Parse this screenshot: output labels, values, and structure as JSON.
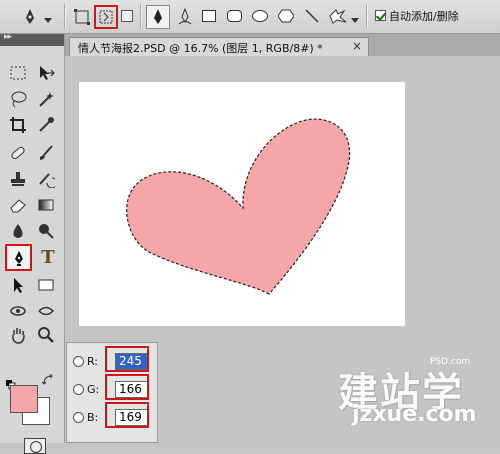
{
  "options_bar": {
    "auto_add_delete_label": "自动添加/删除",
    "auto_add_delete_checked": true
  },
  "toolbox": {
    "header": "▸▸",
    "type_tool_glyph": "T"
  },
  "document": {
    "tab_title": "情人节海报2.PSD @ 16.7% (图层 1, RGB/8#) *",
    "close_glyph": "×"
  },
  "colors": {
    "foreground": "#f5a6a9",
    "background": "#ffffff",
    "heart_fill": "#f5a6a9",
    "highlight_red": "#d0141c"
  },
  "color_panel": {
    "r_label": "R:",
    "g_label": "G:",
    "b_label": "B:",
    "r_value": "245",
    "g_value": "166",
    "b_value": "169"
  },
  "watermark": {
    "main": "建站学",
    "url": "jzxue.com",
    "small": "PSD.com"
  }
}
